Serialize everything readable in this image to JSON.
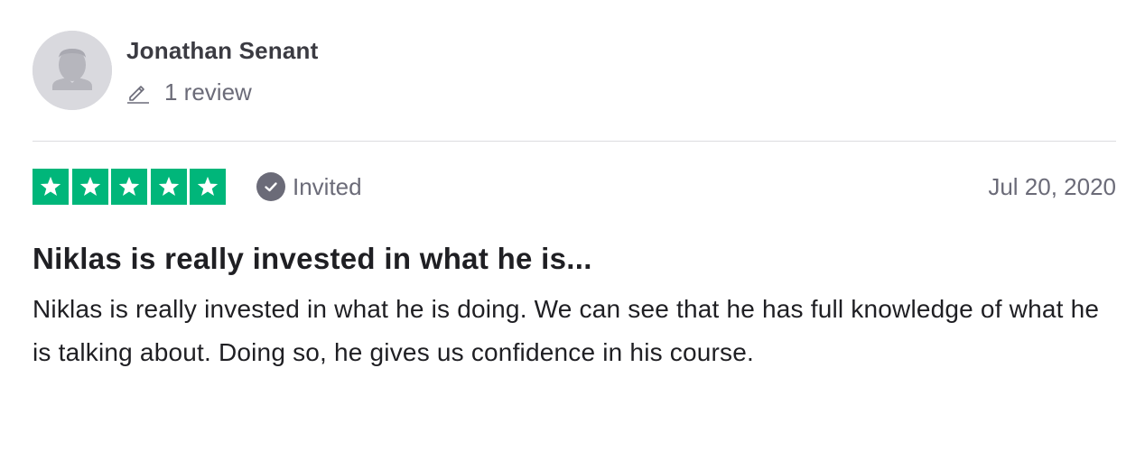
{
  "reviewer": {
    "name": "Jonathan Senant",
    "review_count": "1 review",
    "avatar_icon": "default-user-avatar",
    "count_icon": "pencil-icon"
  },
  "review": {
    "rating": 5,
    "max_rating": 5,
    "star_color": "#00b67a",
    "verification_label": "Invited",
    "verification_icon": "check-circle-icon",
    "date": "Jul 20, 2020",
    "title": "Niklas is really invested in what he is...",
    "body": "Niklas is really invested in what he is doing. We can see that he has full knowledge of what he is talking about. Doing so, he gives us confidence in his course."
  }
}
